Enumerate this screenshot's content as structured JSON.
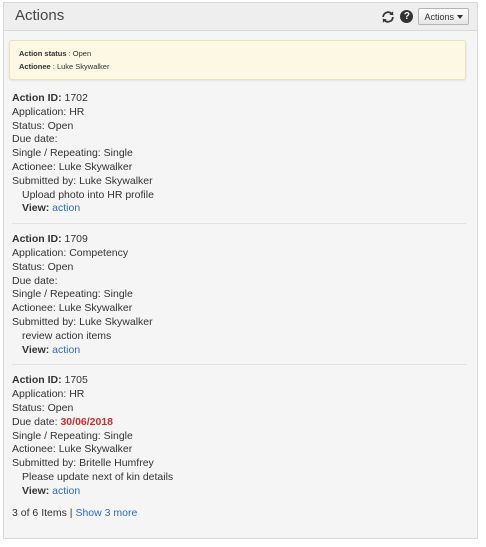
{
  "header": {
    "title": "Actions",
    "actions_button_label": "Actions"
  },
  "alert": {
    "status_label": "Action status",
    "status_value": ": Open",
    "actionee_label": "Actionee",
    "actionee_value": ": Luke Skywalker"
  },
  "items": [
    {
      "id_label": "Action ID:",
      "id_value": " 1702",
      "application": "Application: HR",
      "status": "Status: Open",
      "due_label": "Due date:",
      "due_value": "",
      "repeating": "Single / Repeating: Single",
      "actionee": "Actionee: Luke Skywalker",
      "submitted": "Submitted by: Luke Skywalker",
      "description": "Upload photo into HR profile",
      "view_label": "View:",
      "view_link": "action"
    },
    {
      "id_label": "Action ID:",
      "id_value": " 1709",
      "application": "Application: Competency",
      "status": "Status: Open",
      "due_label": "Due date:",
      "due_value": "",
      "repeating": "Single / Repeating: Single",
      "actionee": "Actionee: Luke Skywalker",
      "submitted": "Submitted by: Luke Skywalker",
      "description": "review action items",
      "view_label": "View:",
      "view_link": "action"
    },
    {
      "id_label": "Action ID:",
      "id_value": " 1705",
      "application": "Application: HR",
      "status": "Status: Open",
      "due_label": "Due date:",
      "due_value": "30/06/2018",
      "repeating": "Single / Repeating: Single",
      "actionee": "Actionee: Luke Skywalker",
      "submitted": "Submitted by: Britelle Humfrey",
      "description": "Please update next of kin details",
      "view_label": "View:",
      "view_link": "action"
    }
  ],
  "footer": {
    "count_text": "3 of 6 Items |",
    "show_more_link": "Show 3 more"
  },
  "colors": {
    "link": "#2a6ebb",
    "due_overdue": "#c9302c",
    "alert_bg": "#fcf8e3"
  },
  "icons": {
    "refresh": "refresh-icon",
    "help": "help-icon",
    "caret": "caret-down-icon"
  }
}
